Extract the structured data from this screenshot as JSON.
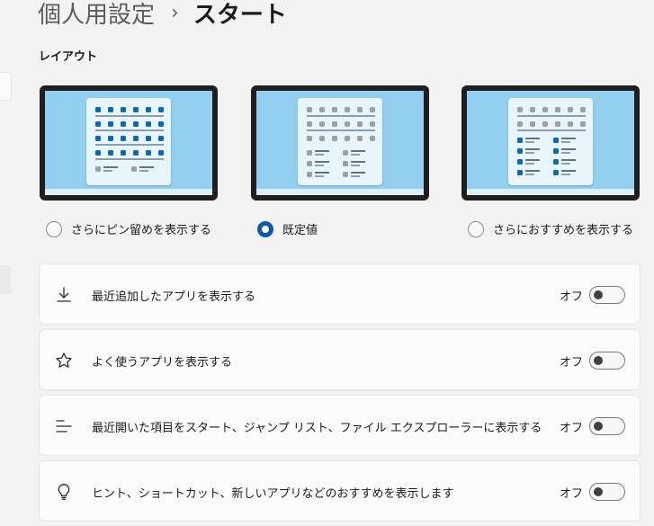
{
  "breadcrumb": {
    "parent": "個人用設定",
    "separator": "›",
    "current": "スタート"
  },
  "layout_section": {
    "title": "レイアウト",
    "options": [
      {
        "label": "さらにピン留めを表示する",
        "selected": false
      },
      {
        "label": "既定値",
        "selected": true
      },
      {
        "label": "さらにおすすめを表示する",
        "selected": false
      }
    ]
  },
  "settings": [
    {
      "icon": "download-icon",
      "label": "最近追加したアプリを表示する",
      "state": "オフ",
      "on": false
    },
    {
      "icon": "star-icon",
      "label": "よく使うアプリを表示する",
      "state": "オフ",
      "on": false
    },
    {
      "icon": "recent-list-icon",
      "label": "最近開いた項目をスタート、ジャンプ リスト、ファイル エクスプローラーに表示する",
      "state": "オフ",
      "on": false
    },
    {
      "icon": "lightbulb-icon",
      "label": "ヒント、ショートカット、新しいアプリなどのおすすめを表示します",
      "state": "オフ",
      "on": false
    }
  ],
  "colors": {
    "accent": "#0f5aa8",
    "tile_blue": "#1167b1",
    "screen_bg": "#92cff0"
  }
}
